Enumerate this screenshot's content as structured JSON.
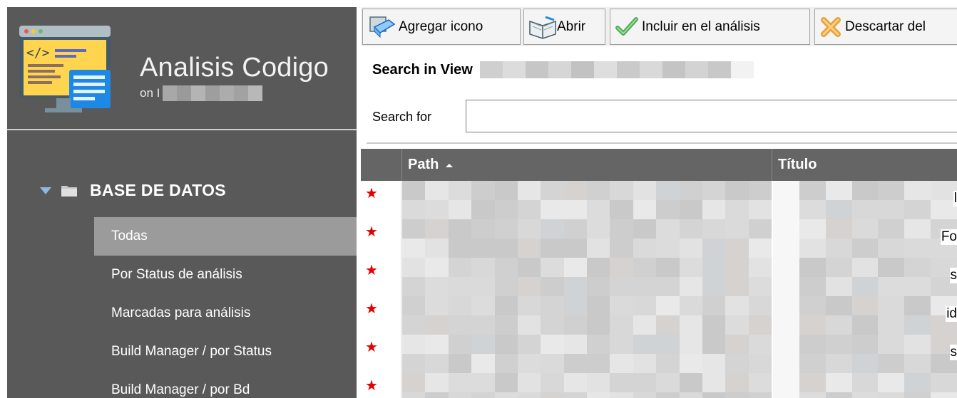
{
  "app": {
    "title": "Analisis Codigo",
    "subtitle_prefix": "on I"
  },
  "sidebar": {
    "root": {
      "label": "BASE DE DATOS",
      "expanded": true
    },
    "items": [
      {
        "label": "Todas",
        "active": true
      },
      {
        "label": "Por Status de análisis",
        "active": false
      },
      {
        "label": "Marcadas para análisis",
        "active": false
      },
      {
        "label": "Build Manager / por Status",
        "active": false
      },
      {
        "label": "Build Manager / por Bd",
        "active": false
      }
    ]
  },
  "toolbar": {
    "buttons": [
      {
        "label": "Agregar icono",
        "icon": "add-icon-icon"
      },
      {
        "label": "Abrir",
        "icon": "open-book-icon"
      },
      {
        "label": "Incluir en el análisis",
        "icon": "checkmark-icon"
      },
      {
        "label": "Descartar del",
        "icon": "discard-x-icon"
      }
    ]
  },
  "search": {
    "view_label": "Search in View",
    "for_label": "Search for",
    "value": "",
    "placeholder": ""
  },
  "grid": {
    "columns": [
      {
        "label": "Path",
        "sort": "ascending"
      },
      {
        "label": "Título"
      }
    ],
    "rows": [
      {
        "flag": "★",
        "title_tail": "l"
      },
      {
        "flag": "★",
        "title_tail": "Fo"
      },
      {
        "flag": "★",
        "title_tail": "s"
      },
      {
        "flag": "★",
        "title_tail": "id"
      },
      {
        "flag": "★",
        "title_tail": "s"
      },
      {
        "flag": "★",
        "title_tail": ""
      }
    ]
  },
  "colors": {
    "sidebar_bg": "#595959",
    "nav_active_bg": "#9b9b9b",
    "grid_header_bg": "#656565",
    "flag_red": "#e00000"
  }
}
